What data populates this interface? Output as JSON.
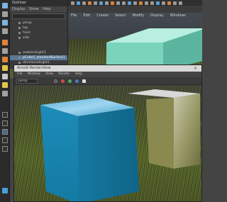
{
  "outliner": {
    "title": "Outliner",
    "menu": [
      "Display",
      "Show",
      "Help"
    ],
    "rows": [
      "persp",
      "top",
      "front",
      "side",
      "ambientLight1",
      "pCube1_standardSurface1",
      "directionalLight1"
    ]
  },
  "main_menu": [
    "File",
    "Edit",
    "Create",
    "Select",
    "Modify",
    "Display",
    "Windows"
  ],
  "render_window": {
    "title": "Arnold RenderView",
    "menu": [
      "File",
      "Window",
      "View",
      "Render",
      "Help"
    ],
    "camera_select": "persp"
  },
  "colors": {
    "selection": "#5b7896",
    "cube_blue": "#1f8db5",
    "cube_teal": "#8fd8c4",
    "grass": "#5a6a2a"
  }
}
